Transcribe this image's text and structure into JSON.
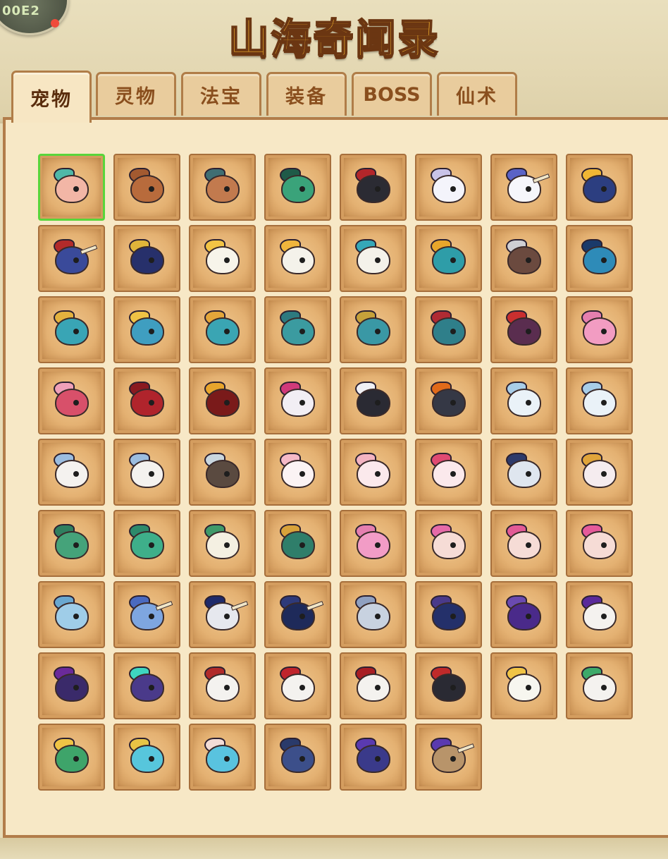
{
  "header": {
    "title": "山海奇闻录",
    "badge_text": "00E2"
  },
  "tabs": [
    {
      "label": "宠物",
      "active": true
    },
    {
      "label": "灵物",
      "active": false
    },
    {
      "label": "法宝",
      "active": false
    },
    {
      "label": "装备",
      "active": false
    },
    {
      "label": "BOSS",
      "active": false
    },
    {
      "label": "仙术",
      "active": false
    }
  ],
  "pets": [
    {
      "icon": "green-monkey-icon",
      "head": "#f2b6a6",
      "crest": "#4fb8a8",
      "horn": false,
      "selected": true
    },
    {
      "icon": "brown-monkey-icon",
      "head": "#b86b3c",
      "crest": "#a35a30",
      "horn": false
    },
    {
      "icon": "dark-monkey-icon",
      "head": "#c27a4e",
      "crest": "#3f6e73",
      "horn": false
    },
    {
      "icon": "green-mask-monkey-icon",
      "head": "#3aa37a",
      "crest": "#1f5a48",
      "horn": false
    },
    {
      "icon": "black-red-warrior-icon",
      "head": "#2b2b33",
      "crest": "#b3262a",
      "horn": false
    },
    {
      "icon": "white-cloud-pony-icon",
      "head": "#f4f4fb",
      "crest": "#c9c3e8",
      "horn": false
    },
    {
      "icon": "blue-unicorn-icon",
      "head": "#f6f6fb",
      "crest": "#5a63c7",
      "horn": true
    },
    {
      "icon": "gold-helmet-knight-icon",
      "head": "#2c3e80",
      "crest": "#f0b634",
      "horn": false
    },
    {
      "icon": "red-horned-knight-icon",
      "head": "#3a4a9a",
      "crest": "#b32a2a",
      "horn": true
    },
    {
      "icon": "gold-dragon-helm-icon",
      "head": "#27306b",
      "crest": "#e0b53a",
      "horn": false
    },
    {
      "icon": "white-gold-bird-icon",
      "head": "#f7f4ea",
      "crest": "#f2c445",
      "horn": false
    },
    {
      "icon": "teal-gold-bird-icon",
      "head": "#f4f2ea",
      "crest": "#f0b53c",
      "horn": false
    },
    {
      "icon": "teal-armor-bird-icon",
      "head": "#f4f2ea",
      "crest": "#35a8b8",
      "horn": false
    },
    {
      "icon": "gold-teal-dragon-icon",
      "head": "#2e9da8",
      "crest": "#e8a62b",
      "horn": false
    },
    {
      "icon": "grey-wolf-beast-icon",
      "head": "#6b4a3f",
      "crest": "#cfcfd4",
      "horn": false
    },
    {
      "icon": "teal-ball-knight-icon",
      "head": "#2e8bb8",
      "crest": "#1a3a6a",
      "horn": false
    },
    {
      "icon": "teal-helmet-fish-icon",
      "head": "#39a5b5",
      "crest": "#e4b23e",
      "horn": false
    },
    {
      "icon": "gold-horn-fish-icon",
      "head": "#3f9ec0",
      "crest": "#efc245",
      "horn": false
    },
    {
      "icon": "teal-armored-dragon-icon",
      "head": "#3aa5b3",
      "crest": "#e3a63a",
      "horn": false
    },
    {
      "icon": "teal-fish-head-icon",
      "head": "#3b9ba0",
      "crest": "#2d7a7f",
      "horn": false
    },
    {
      "icon": "teal-fin-fish-icon",
      "head": "#3a98a5",
      "crest": "#c6a13a",
      "horn": false
    },
    {
      "icon": "teal-horn-demon-icon",
      "head": "#2f7f8a",
      "crest": "#b02b33",
      "horn": false
    },
    {
      "icon": "red-gold-demon-icon",
      "head": "#5a2d4f",
      "crest": "#c92f2f",
      "horn": false
    },
    {
      "icon": "pink-chick-icon",
      "head": "#f29cc2",
      "crest": "#e57fae",
      "horn": false
    },
    {
      "icon": "pink-red-bird-icon",
      "head": "#d8506a",
      "crest": "#f0a0b8",
      "horn": false
    },
    {
      "icon": "red-phoenix-icon",
      "head": "#b0242c",
      "crest": "#8a1a20",
      "horn": false
    },
    {
      "icon": "dark-red-phoenix-icon",
      "head": "#7a1a1a",
      "crest": "#e8a52c",
      "horn": false
    },
    {
      "icon": "pink-horse-icon",
      "head": "#f2eef4",
      "crest": "#d03a7a",
      "horn": false
    },
    {
      "icon": "black-white-wolf-icon",
      "head": "#2a2a33",
      "crest": "#f0f0f4",
      "horn": false
    },
    {
      "icon": "dark-armor-wolf-icon",
      "head": "#353845",
      "crest": "#e06a1a",
      "horn": false
    },
    {
      "icon": "fluffy-sheep-icon",
      "head": "#eaf2f8",
      "crest": "#a8cde8",
      "horn": false
    },
    {
      "icon": "fluffy-sheep-big-icon",
      "head": "#eaf2f8",
      "crest": "#a8cde8",
      "horn": false
    },
    {
      "icon": "blue-horn-sheep-icon",
      "head": "#f4f2ef",
      "crest": "#9bbde0",
      "horn": false
    },
    {
      "icon": "green-face-sheep-icon",
      "head": "#f4f2ef",
      "crest": "#9bbde0",
      "horn": false
    },
    {
      "icon": "machine-vehicle-icon",
      "head": "#5a4a40",
      "crest": "#c9d6de",
      "horn": false
    },
    {
      "icon": "white-rabbit-icon",
      "head": "#fbf3f4",
      "crest": "#f5b9c7",
      "horn": false
    },
    {
      "icon": "pink-rabbit-icon",
      "head": "#fbe9ec",
      "crest": "#f3b4c2",
      "horn": false
    },
    {
      "icon": "crystal-rabbit-icon",
      "head": "#fbe9ec",
      "crest": "#e04a72",
      "horn": false
    },
    {
      "icon": "silver-mecha-rabbit-icon",
      "head": "#dfe6ef",
      "crest": "#2d3a6a",
      "horn": false
    },
    {
      "icon": "gold-red-rabbit-icon",
      "head": "#f5ecef",
      "crest": "#e0a43a",
      "horn": false
    },
    {
      "icon": "green-chick-icon",
      "head": "#45a37a",
      "crest": "#2f7f5f",
      "horn": false
    },
    {
      "icon": "teal-bird-icon",
      "head": "#3eaf8a",
      "crest": "#2d8a6b",
      "horn": false
    },
    {
      "icon": "green-owl-icon",
      "head": "#f4f0e2",
      "crest": "#3f9a6a",
      "horn": false
    },
    {
      "icon": "gold-feather-bird-icon",
      "head": "#2f7e6a",
      "crest": "#d8a23a",
      "horn": false
    },
    {
      "icon": "pink-blob-icon",
      "head": "#f29cc6",
      "crest": "#e57fb0",
      "horn": false
    },
    {
      "icon": "pink-fairy-girl-icon",
      "head": "#f6dcd6",
      "crest": "#e66aa8",
      "horn": false
    },
    {
      "icon": "pink-wing-girl-icon",
      "head": "#f6dcd6",
      "crest": "#e35a96",
      "horn": false
    },
    {
      "icon": "purple-wing-girl-icon",
      "head": "#f6dcd6",
      "crest": "#e55a9a",
      "horn": false
    },
    {
      "icon": "light-blue-pony-icon",
      "head": "#9fcde8",
      "crest": "#6aa8d0",
      "horn": false
    },
    {
      "icon": "blue-unicorn-small-icon",
      "head": "#7ea6e0",
      "crest": "#4a6ac0",
      "horn": true
    },
    {
      "icon": "navy-helm-unicorn-icon",
      "head": "#e6e8ee",
      "crest": "#1e2a6a",
      "horn": true
    },
    {
      "icon": "dark-navy-unicorn-icon",
      "head": "#1e2a5a",
      "crest": "#2e3a7a",
      "horn": true
    },
    {
      "icon": "silver-armor-dragon-icon",
      "head": "#c8d2e0",
      "crest": "#8fa0c0",
      "horn": false
    },
    {
      "icon": "purple-helm-ball-icon",
      "head": "#24306a",
      "crest": "#4a3a8a",
      "horn": false
    },
    {
      "icon": "purple-horn-ball-icon",
      "head": "#4a2a8a",
      "crest": "#6a4ab0",
      "horn": false
    },
    {
      "icon": "purple-feather-knight-icon",
      "head": "#f4f2ef",
      "crest": "#5a2a9a",
      "horn": false
    },
    {
      "icon": "dark-purple-dragon-icon",
      "head": "#3a2a6a",
      "crest": "#6a2a9a",
      "horn": false
    },
    {
      "icon": "glowing-purple-dragon-icon",
      "head": "#4a3a8a",
      "crest": "#3ed6c0",
      "horn": false
    },
    {
      "icon": "white-red-bird-icon",
      "head": "#f4f2ef",
      "crest": "#b02a2a",
      "horn": false
    },
    {
      "icon": "white-red-horn-bird-icon",
      "head": "#f4f2ef",
      "crest": "#c0242c",
      "horn": false
    },
    {
      "icon": "black-red-horn-bird-icon",
      "head": "#f4f2ef",
      "crest": "#a81e24",
      "horn": false
    },
    {
      "icon": "red-gold-horn-demon-icon",
      "head": "#2a2a33",
      "crest": "#c02a2a",
      "horn": false
    },
    {
      "icon": "white-chick-icon",
      "head": "#f7f6ef",
      "crest": "#f0c445",
      "horn": false
    },
    {
      "icon": "green-white-eagle-icon",
      "head": "#f4f2ef",
      "crest": "#3eaa6a",
      "horn": false
    },
    {
      "icon": "green-parrot-icon",
      "head": "#3ea46a",
      "crest": "#f0c445",
      "horn": false
    },
    {
      "icon": "cyan-hair-mask-icon",
      "head": "#57c6dc",
      "crest": "#e8c445",
      "horn": false
    },
    {
      "icon": "cyan-hair-girl-icon",
      "head": "#59c3df",
      "crest": "#f2dcd6",
      "horn": false
    },
    {
      "icon": "dark-blue-beast-icon",
      "head": "#3c4f8a",
      "crest": "#2a3a6a",
      "horn": false
    },
    {
      "icon": "purple-horse-icon",
      "head": "#3a3a8a",
      "crest": "#5a3ab0",
      "horn": false
    },
    {
      "icon": "purple-crest-helmet-icon",
      "head": "#b8946a",
      "crest": "#5a3ab0",
      "horn": true
    }
  ]
}
